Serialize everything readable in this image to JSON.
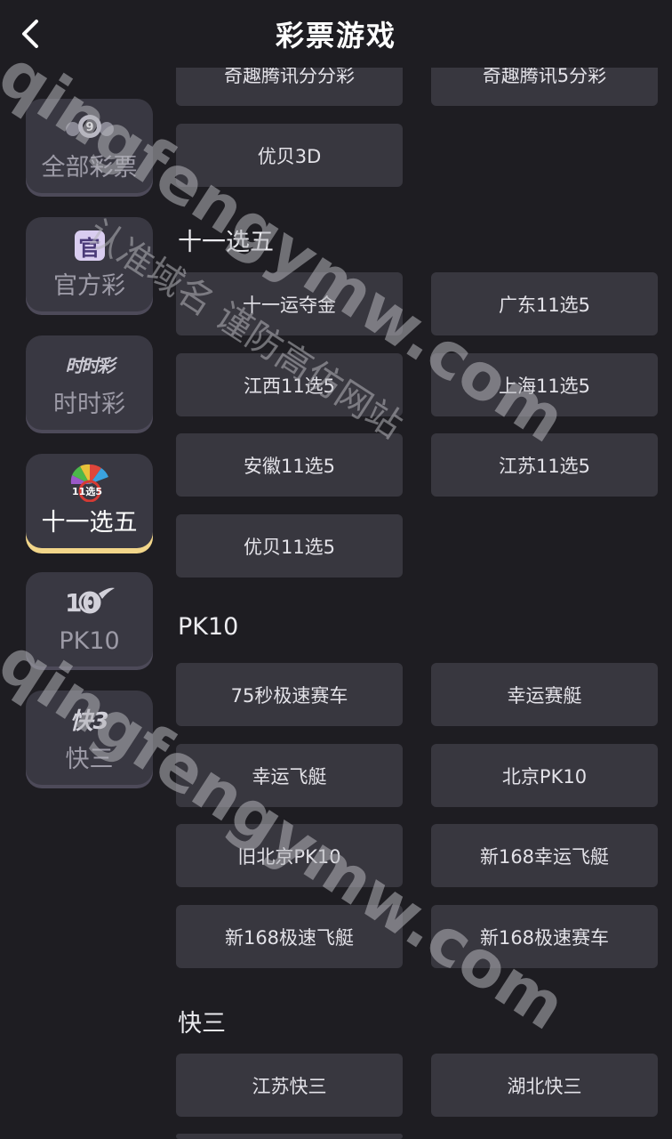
{
  "header": {
    "title": "彩票游戏",
    "back_icon": "chevron-left-icon"
  },
  "sidebar": {
    "items": [
      {
        "label": "全部彩票",
        "icon": "lottery-ball-icon",
        "active": false
      },
      {
        "label": "官方彩",
        "icon": "official-badge-icon",
        "active": false
      },
      {
        "label": "时时彩",
        "icon": "shishicai-logo-icon",
        "active": false
      },
      {
        "label": "十一选五",
        "icon": "eleven-pick-five-logo-icon",
        "active": true
      },
      {
        "label": "PK10",
        "icon": "pk10-wheel-icon",
        "active": false
      },
      {
        "label": "快三",
        "icon": "kuaisan-logo-icon",
        "active": false
      }
    ],
    "icon_texts": {
      "ball": "9",
      "official": "官",
      "ssc": "时时彩",
      "syxw": "11选5",
      "pk": "10",
      "k3": "快3"
    }
  },
  "content": {
    "top_games": [
      "奇趣腾讯分分彩",
      "奇趣腾讯5分彩",
      "优贝3D"
    ],
    "sections": [
      {
        "title": "十一选五",
        "games": [
          "十一运夺金",
          "广东11选5",
          "江西11选5",
          "上海11选5",
          "安徽11选5",
          "江苏11选5",
          "优贝11选5"
        ]
      },
      {
        "title": "PK10",
        "games": [
          "75秒极速赛车",
          "幸运赛艇",
          "幸运飞艇",
          "北京PK10",
          "旧北京PK10",
          "新168幸运飞艇",
          "新168极速飞艇",
          "新168极速赛车"
        ]
      },
      {
        "title": "快三",
        "games": [
          "江苏快三",
          "湖北快三"
        ]
      }
    ]
  },
  "watermark": {
    "domain": "qingfengymw.com",
    "slogan": "认准域名 谨防高仿网站"
  },
  "colors": {
    "background": "#1e1d22",
    "card": "#38373f",
    "sidebar_card": "#393842",
    "active_underline": "#f2d68a"
  }
}
